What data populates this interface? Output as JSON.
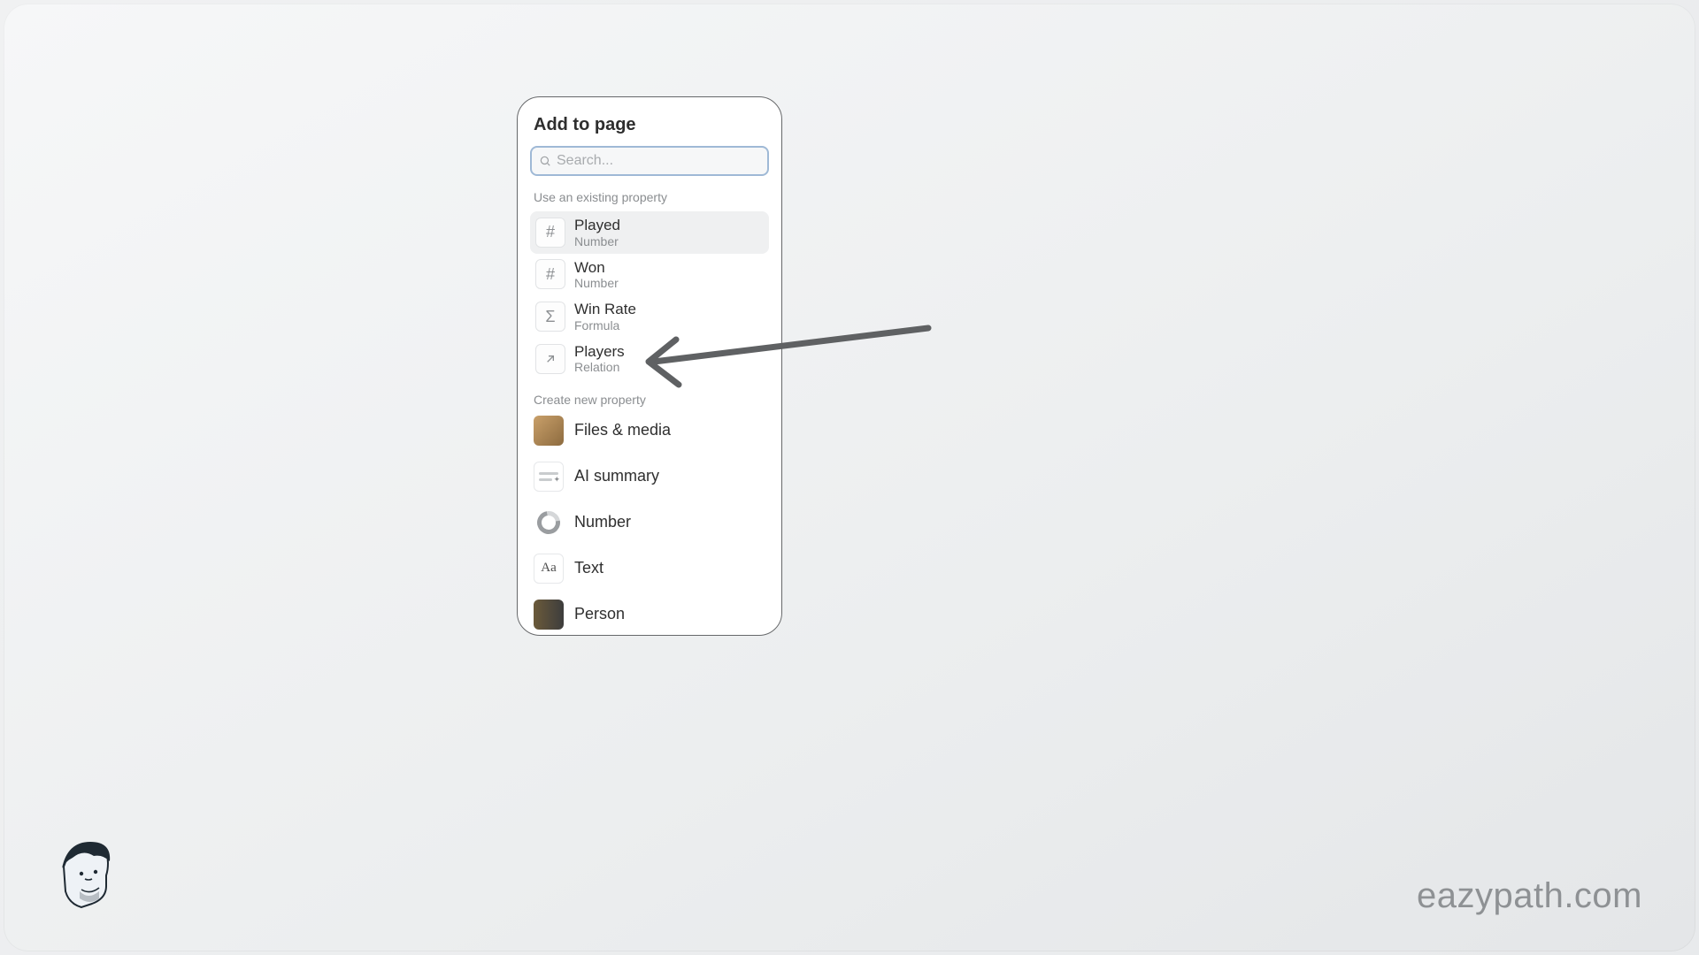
{
  "popover": {
    "title": "Add to page",
    "search_placeholder": "Search...",
    "section_existing": "Use an existing property",
    "section_create": "Create new property",
    "existing": [
      {
        "name": "Played",
        "type": "Number",
        "icon": "hash",
        "highlight": true
      },
      {
        "name": "Won",
        "type": "Number",
        "icon": "hash",
        "highlight": false
      },
      {
        "name": "Win Rate",
        "type": "Formula",
        "icon": "sigma",
        "highlight": false
      },
      {
        "name": "Players",
        "type": "Relation",
        "icon": "arrow-ne",
        "highlight": false
      }
    ],
    "create": [
      {
        "label": "Files & media",
        "icon": "files"
      },
      {
        "label": "AI summary",
        "icon": "ai"
      },
      {
        "label": "Number",
        "icon": "ring"
      },
      {
        "label": "Text",
        "icon": "text-aa"
      },
      {
        "label": "Person",
        "icon": "person"
      }
    ]
  },
  "watermark": "eazypath.com"
}
